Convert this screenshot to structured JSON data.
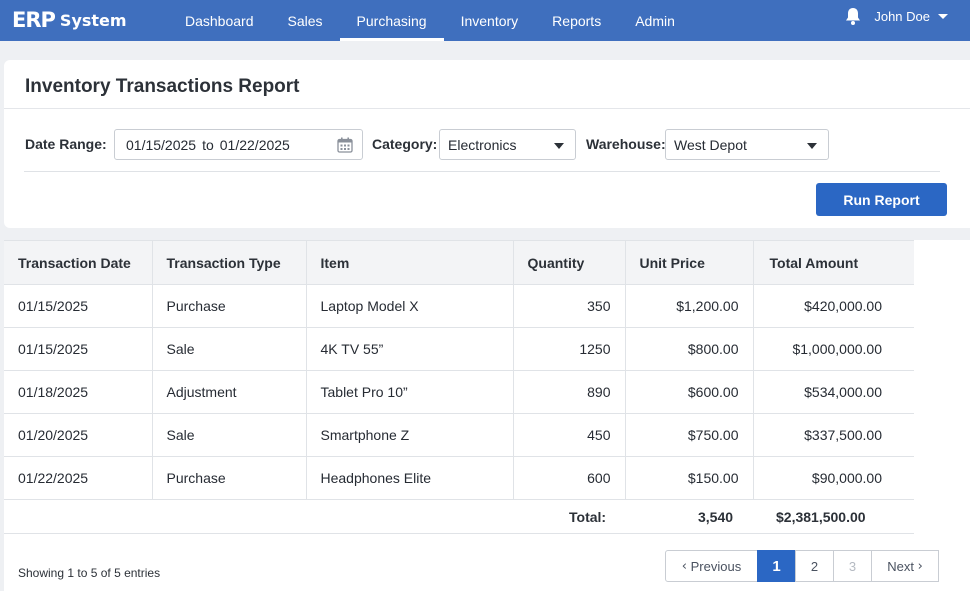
{
  "app": {
    "logo_mark": "ERP",
    "logo_word": "System"
  },
  "nav": {
    "items": [
      {
        "label": "Dashboard"
      },
      {
        "label": "Sales"
      },
      {
        "label": "Purchasing",
        "active": true
      },
      {
        "label": "Inventory"
      },
      {
        "label": "Reports"
      },
      {
        "label": "Admin"
      }
    ]
  },
  "user": {
    "name": "John Doe",
    "icon": "bell-icon"
  },
  "report": {
    "title": "Inventory Transactions Report",
    "filters": {
      "date_range_label": "Date Range:",
      "date_from": "01/15/2025",
      "date_to_word": "to",
      "date_to": "01/22/2025",
      "category_label": "Category:",
      "category_value": "Electronics",
      "warehouse_label": "Warehouse:",
      "warehouse_value": "West Depot"
    },
    "run_button": "Run Report"
  },
  "table": {
    "columns": [
      "Transaction Date",
      "Transaction Type",
      "Item",
      "Quantity",
      "Unit Price",
      "Total Amount"
    ],
    "rows": [
      {
        "date": "01/15/2025",
        "type": "Purchase",
        "item": "Laptop Model X",
        "qty": "350",
        "unit_price": "$1,200.00",
        "total": "$420,000.00"
      },
      {
        "date": "01/15/2025",
        "type": "Sale",
        "item": "4K TV 55”",
        "qty": "1250",
        "unit_price": "$800.00",
        "total": "$1,000,000.00"
      },
      {
        "date": "01/18/2025",
        "type": "Adjustment",
        "item": "Tablet Pro 10”",
        "qty": "890",
        "unit_price": "$600.00",
        "total": "$534,000.00"
      },
      {
        "date": "01/20/2025",
        "type": "Sale",
        "item": "Smartphone Z",
        "qty": "450",
        "unit_price": "$750.00",
        "total": "$337,500.00"
      },
      {
        "date": "01/22/2025",
        "type": "Purchase",
        "item": "Headphones Elite",
        "qty": "600",
        "unit_price": "$150.00",
        "total": "$90,000.00"
      }
    ],
    "totals": {
      "label": "Total:",
      "qty": "3,540",
      "amount": "$2,381,500.00"
    }
  },
  "footer": {
    "showing": "Showing 1 to 5 of 5 entries",
    "pagination": {
      "previous": "Previous",
      "next": "Next",
      "pages": [
        "1",
        "2",
        "3"
      ],
      "current": "1",
      "disabled": [
        "3"
      ]
    }
  },
  "colors": {
    "header_bg": "#3f6fbe",
    "primary": "#2b67c4"
  }
}
